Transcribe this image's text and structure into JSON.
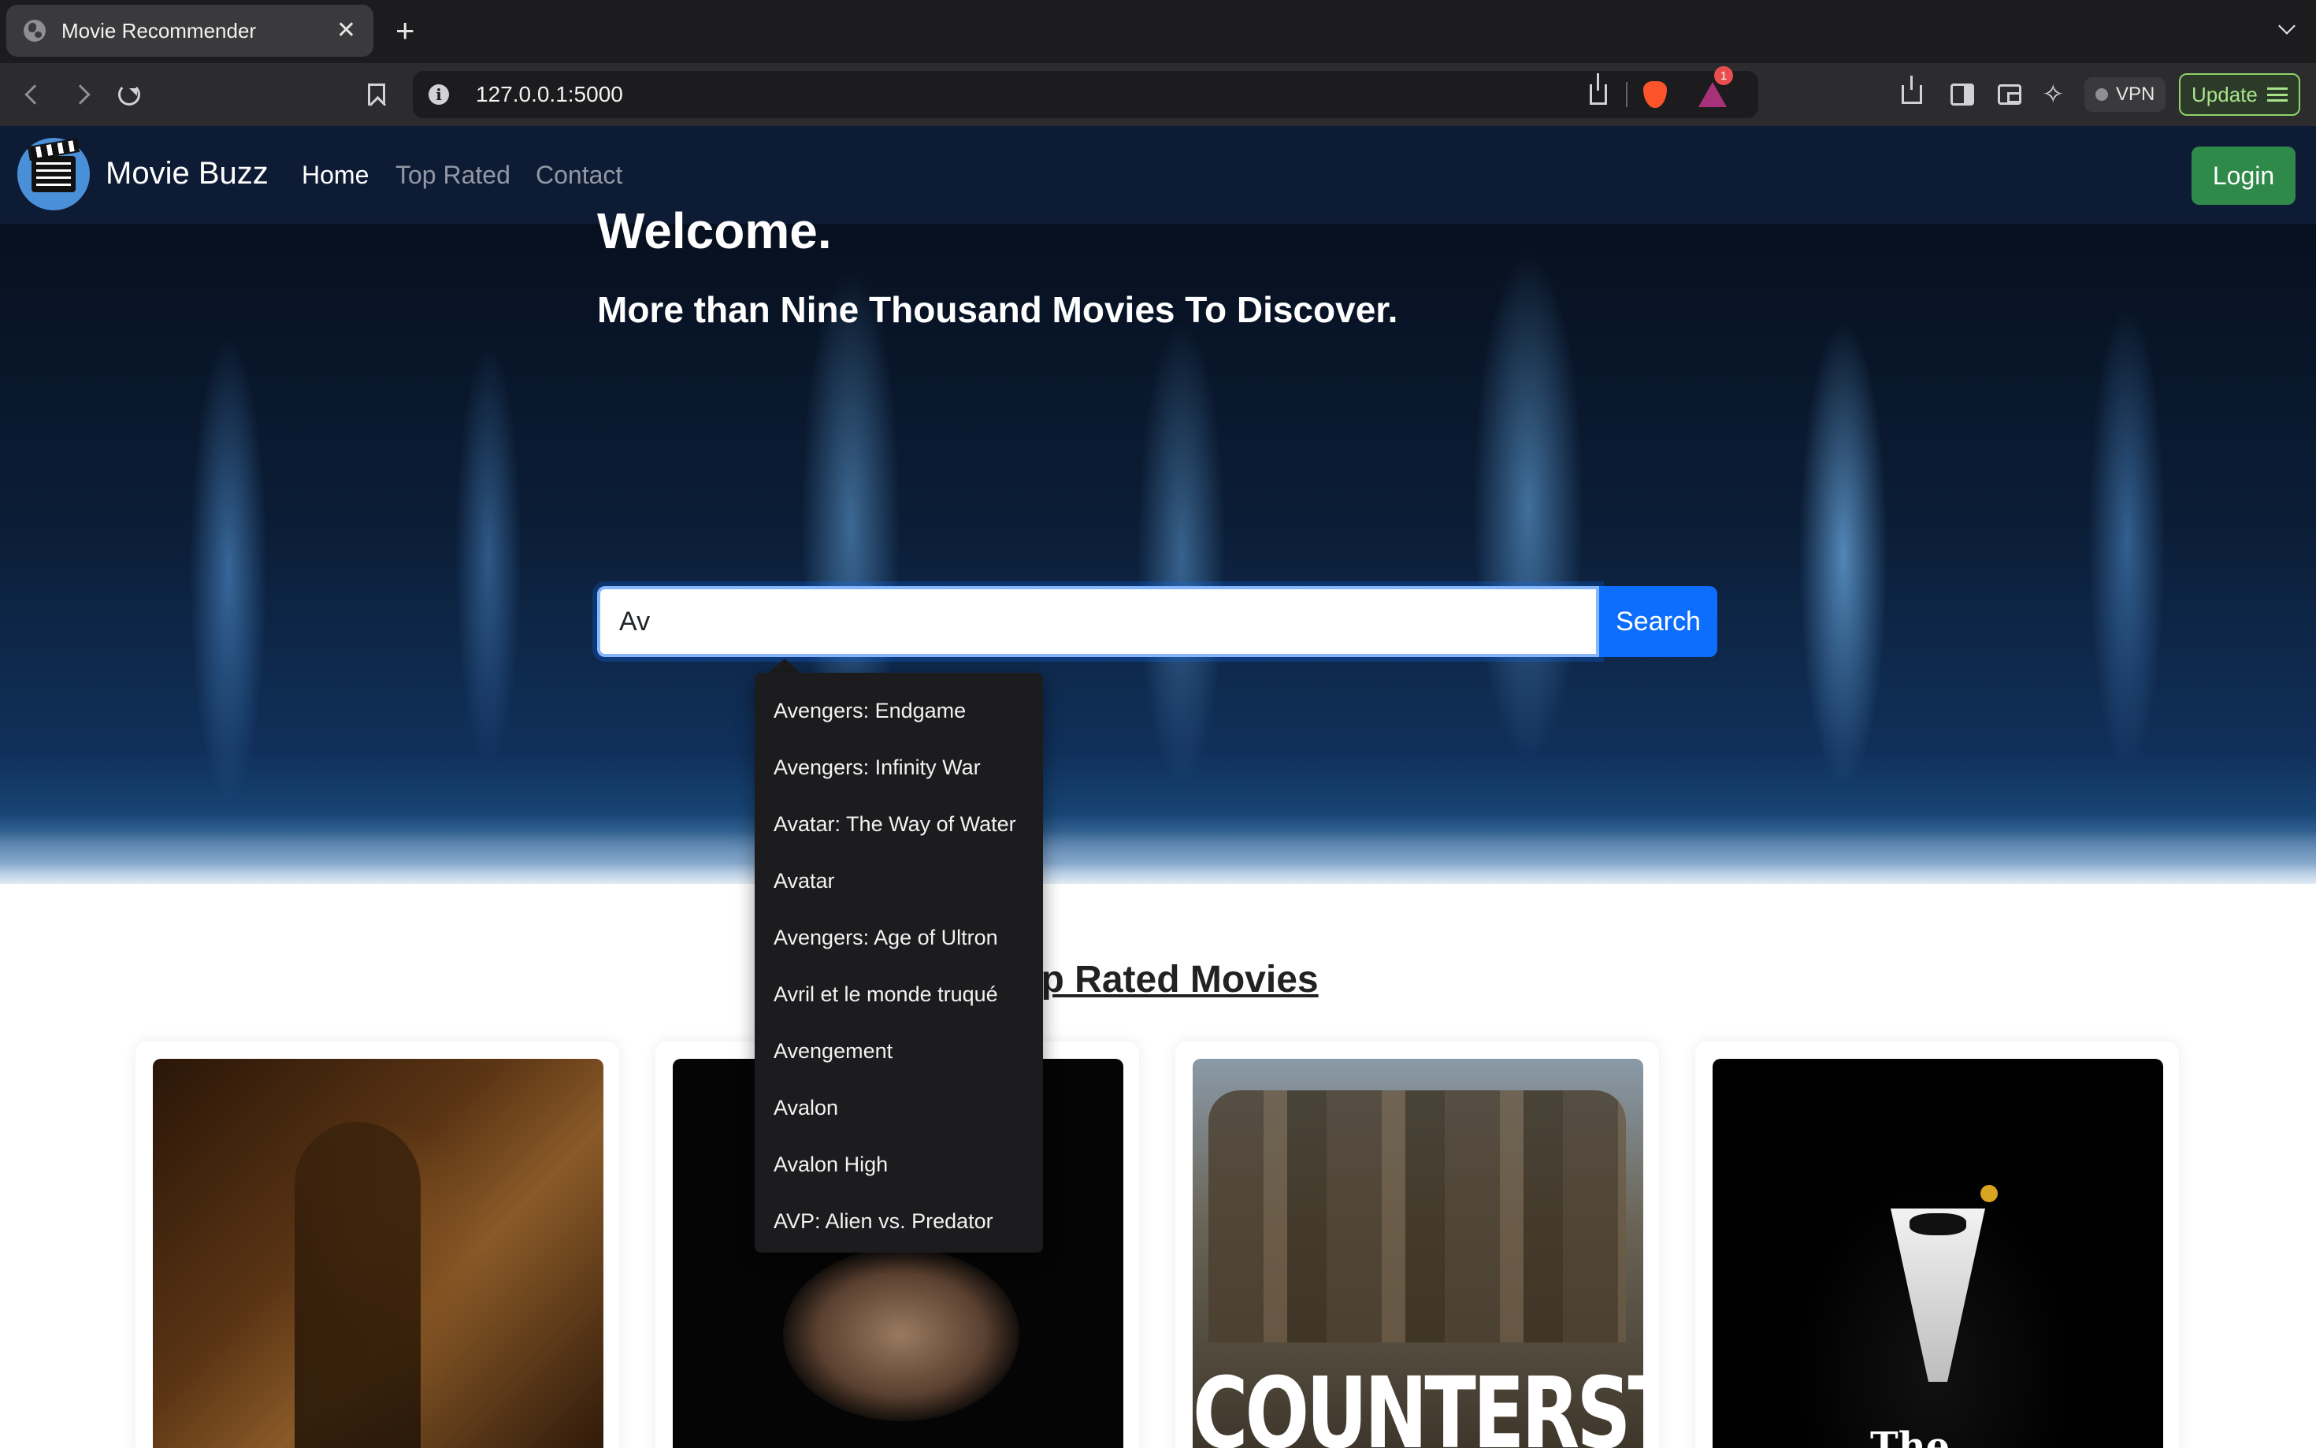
{
  "browser": {
    "tab_title": "Movie Recommender",
    "tab_close": "✕",
    "new_tab": "+",
    "url": "127.0.0.1:5000",
    "rewards_badge": "1",
    "vpn_label": "VPN",
    "update_label": "Update"
  },
  "navbar": {
    "brand": "Movie Buzz",
    "links": [
      {
        "label": "Home",
        "active": true
      },
      {
        "label": "Top Rated",
        "active": false
      },
      {
        "label": "Contact",
        "active": false
      }
    ],
    "login_label": "Login"
  },
  "hero": {
    "title": "Welcome.",
    "subtitle": "More than Nine Thousand Movies To Discover.",
    "search_value": "Av",
    "search_button": "Search"
  },
  "autocomplete": [
    "Avengers: Endgame",
    "Avengers: Infinity War",
    "Avatar: The Way of Water",
    "Avatar",
    "Avengers: Age of Ultron",
    "Avril et le monde truqué",
    "Avengement",
    "Avalon",
    "Avalon High",
    "AVP: Alien vs. Predator"
  ],
  "top_rated": {
    "title": "Top Rated Movies",
    "poster_texts": [
      "COUNTERSTRIKE",
      "The"
    ]
  },
  "colors": {
    "navbar_bg": "#0d1b35",
    "primary": "#0d6efd",
    "login_green": "#2f8a4a",
    "dropdown_bg": "#1c1c1e"
  }
}
